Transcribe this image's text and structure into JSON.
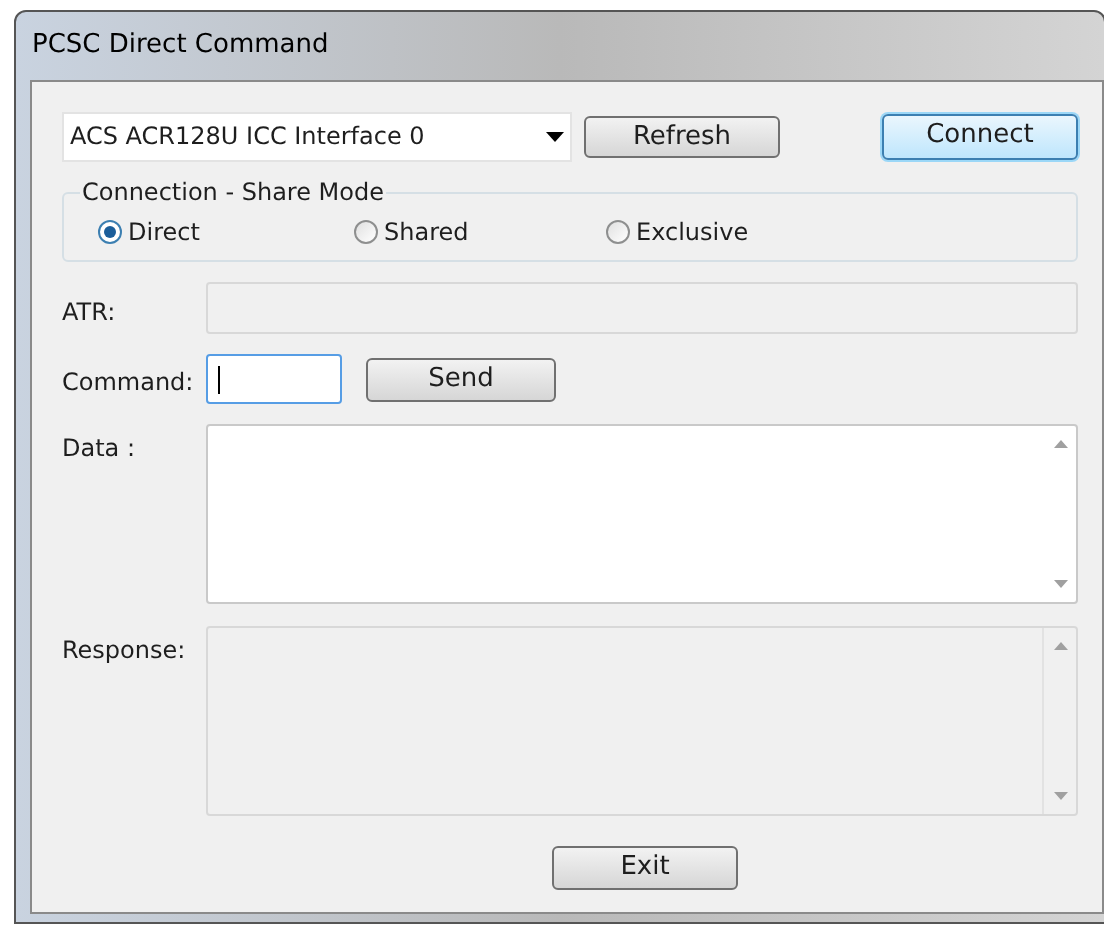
{
  "window": {
    "title": "PCSC Direct Command"
  },
  "reader": {
    "value": "ACS ACR128U ICC Interface 0"
  },
  "refresh_button": "Refresh",
  "connect_button": "Connect",
  "share_mode": {
    "legend": "Connection - Share Mode",
    "options": [
      {
        "label": "Direct",
        "selected": true
      },
      {
        "label": "Shared",
        "selected": false
      },
      {
        "label": "Exclusive",
        "selected": false
      }
    ]
  },
  "fields": [
    {
      "kind": "line",
      "label": "ATR:",
      "disabled": true
    },
    {
      "kind": "command",
      "label": "Command:",
      "disabled": false,
      "button": "Send"
    },
    {
      "kind": "area",
      "label": "Data :",
      "disabled": false
    },
    {
      "kind": "area",
      "label": "Response:",
      "disabled": true
    }
  ],
  "exit_button": "Exit"
}
